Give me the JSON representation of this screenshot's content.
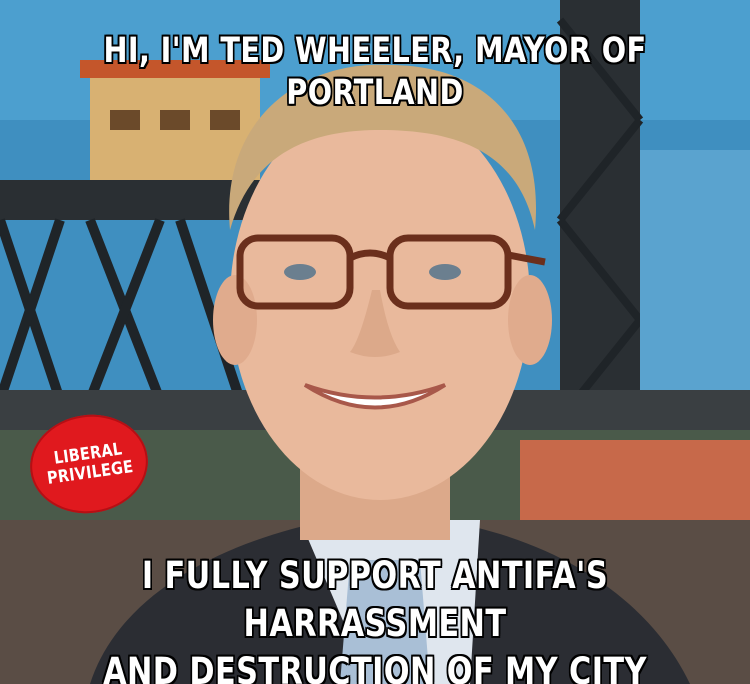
{
  "meme": {
    "top_text": "HI, I'M TED WHEELER, MAYOR OF PORTLAND",
    "bottom_line_1": "I FULLY SUPPORT ANTIFA'S HARRASSMENT",
    "bottom_line_2": "AND DESTRUCTION OF MY CITY"
  },
  "badge": {
    "line_1": "LIBERAL",
    "line_2": "PRIVILEGE",
    "color": "#e0191e"
  },
  "colors": {
    "sky": "#3f8fc0",
    "bridge": "#2a2f33",
    "skin": "#e9b99c",
    "hair": "#c9a97a",
    "suit": "#2b2d33",
    "shirt": "#dfe6ee"
  }
}
